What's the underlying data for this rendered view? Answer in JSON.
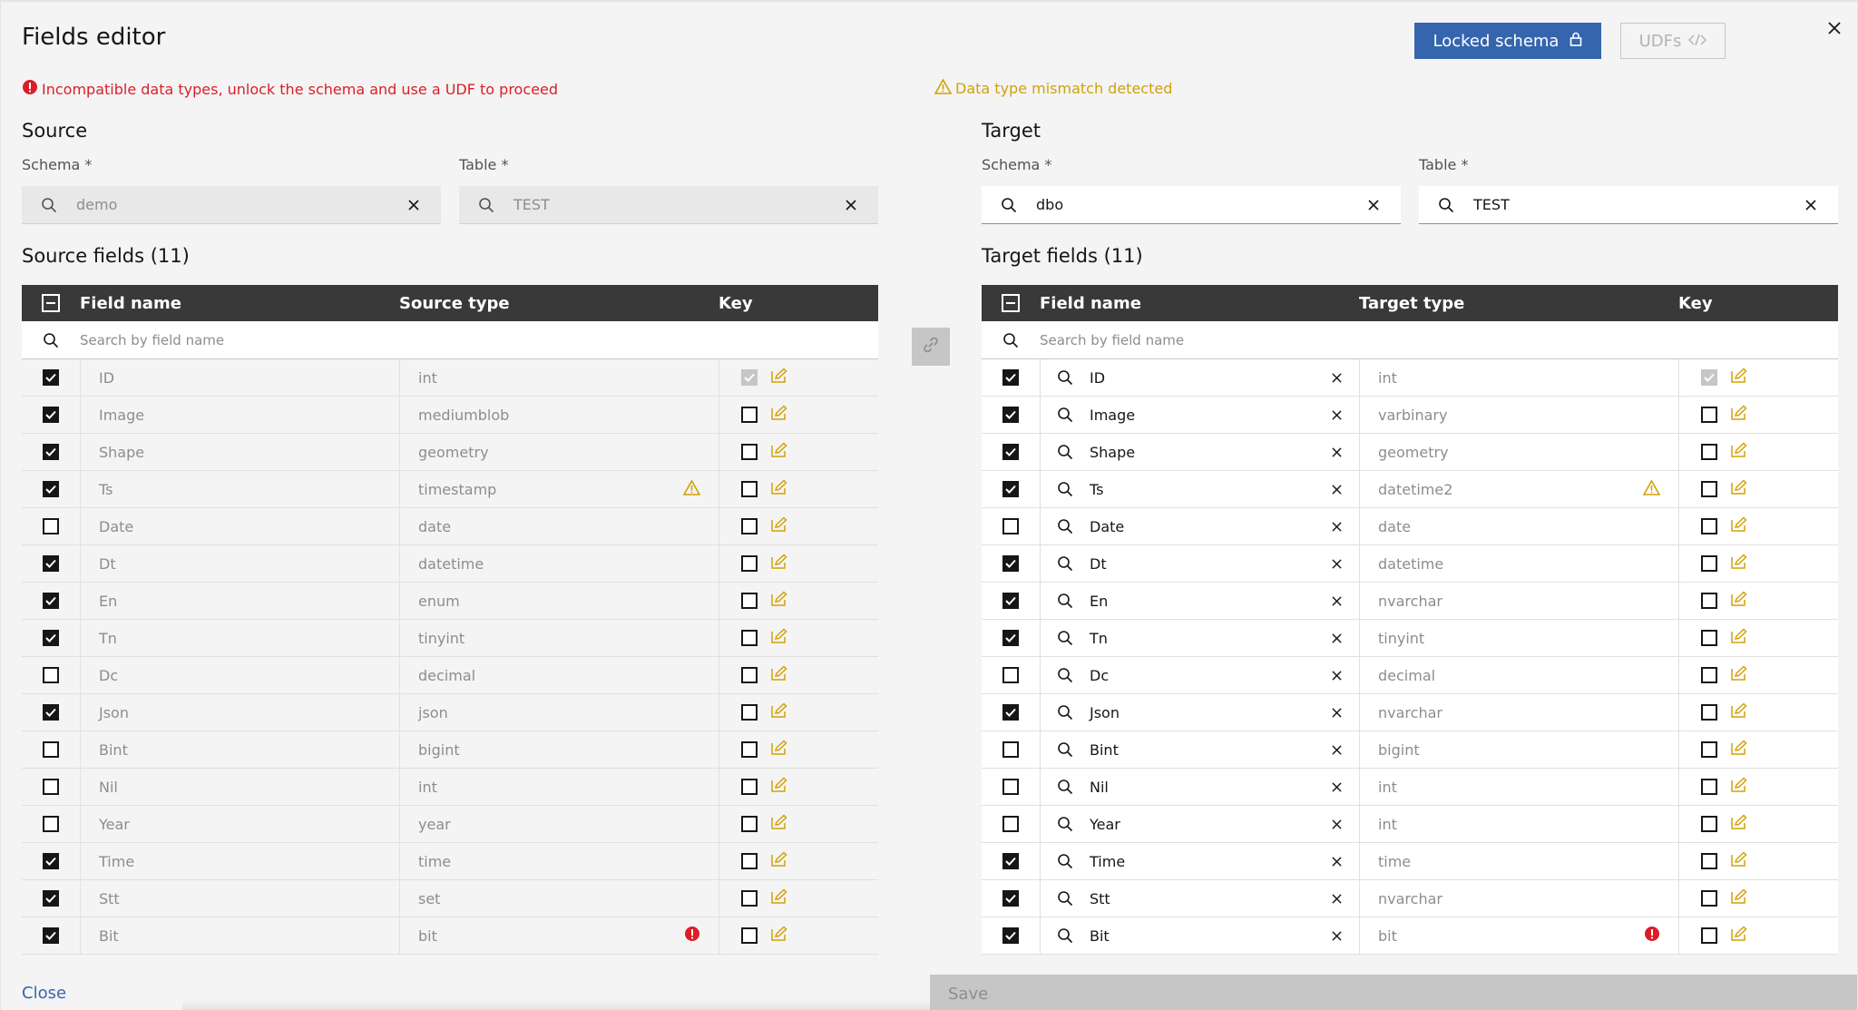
{
  "dialog": {
    "title": "Fields editor",
    "locked_schema_label": "Locked schema",
    "udfs_label": "UDFs"
  },
  "messages": {
    "error": "Incompatible data types, unlock the schema and use a UDF to proceed",
    "warning": "Data type mismatch detected"
  },
  "source": {
    "title": "Source",
    "schema_label": "Schema *",
    "schema_value": "demo",
    "table_label": "Table *",
    "table_value": "TEST",
    "fields_title": "Source fields (11)",
    "columns": {
      "name": "Field name",
      "type": "Source type",
      "key": "Key"
    },
    "search_placeholder": "Search by field name"
  },
  "target": {
    "title": "Target",
    "schema_label": "Schema *",
    "schema_value": "dbo",
    "table_label": "Table *",
    "table_value": "TEST",
    "fields_title": "Target fields (11)",
    "columns": {
      "name": "Field name",
      "type": "Target type",
      "key": "Key"
    },
    "search_placeholder": "Search by field name"
  },
  "rows": [
    {
      "checked": true,
      "name": "ID",
      "source_type": "int",
      "target_type": "int",
      "key": true,
      "status": ""
    },
    {
      "checked": true,
      "name": "Image",
      "source_type": "mediumblob",
      "target_type": "varbinary",
      "key": false,
      "status": ""
    },
    {
      "checked": true,
      "name": "Shape",
      "source_type": "geometry",
      "target_type": "geometry",
      "key": false,
      "status": ""
    },
    {
      "checked": true,
      "name": "Ts",
      "source_type": "timestamp",
      "target_type": "datetime2",
      "key": false,
      "status": "warning"
    },
    {
      "checked": false,
      "name": "Date",
      "source_type": "date",
      "target_type": "date",
      "key": false,
      "status": ""
    },
    {
      "checked": true,
      "name": "Dt",
      "source_type": "datetime",
      "target_type": "datetime",
      "key": false,
      "status": ""
    },
    {
      "checked": true,
      "name": "En",
      "source_type": "enum",
      "target_type": "nvarchar",
      "key": false,
      "status": ""
    },
    {
      "checked": true,
      "name": "Tn",
      "source_type": "tinyint",
      "target_type": "tinyint",
      "key": false,
      "status": ""
    },
    {
      "checked": false,
      "name": "Dc",
      "source_type": "decimal",
      "target_type": "decimal",
      "key": false,
      "status": ""
    },
    {
      "checked": true,
      "name": "Json",
      "source_type": "json",
      "target_type": "nvarchar",
      "key": false,
      "status": ""
    },
    {
      "checked": false,
      "name": "Bint",
      "source_type": "bigint",
      "target_type": "bigint",
      "key": false,
      "status": ""
    },
    {
      "checked": false,
      "name": "Nil",
      "source_type": "int",
      "target_type": "int",
      "key": false,
      "status": ""
    },
    {
      "checked": false,
      "name": "Year",
      "source_type": "year",
      "target_type": "int",
      "key": false,
      "status": ""
    },
    {
      "checked": true,
      "name": "Time",
      "source_type": "time",
      "target_type": "time",
      "key": false,
      "status": ""
    },
    {
      "checked": true,
      "name": "Stt",
      "source_type": "set",
      "target_type": "nvarchar",
      "key": false,
      "status": ""
    },
    {
      "checked": true,
      "name": "Bit",
      "source_type": "bit",
      "target_type": "bit",
      "key": false,
      "status": "error"
    }
  ],
  "footer": {
    "close_label": "Close",
    "save_label": "Save"
  },
  "colors": {
    "primary": "#3565ad",
    "error": "#da1e28",
    "warning": "#d2a106",
    "header": "#393939"
  }
}
